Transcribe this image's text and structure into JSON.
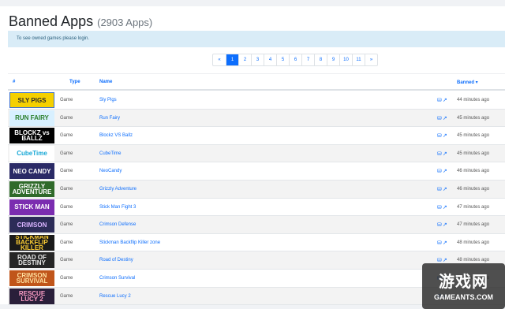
{
  "page": {
    "title": "Banned Apps",
    "count": "(2903 Apps)",
    "alert": "To see owned games please login."
  },
  "pagination": [
    "«",
    "1",
    "2",
    "3",
    "4",
    "5",
    "6",
    "7",
    "8",
    "9",
    "10",
    "11",
    "»"
  ],
  "pagination_active": "1",
  "table": {
    "headers": {
      "num": "#",
      "type": "Type",
      "name": "Name",
      "banned": "Banned ▾"
    },
    "rows": [
      {
        "thumb": "SLY PIGS",
        "type": "Game",
        "name": "Sly Pigs",
        "when": "44 minutes ago",
        "bg": "#f5d000",
        "fg": "#2b2b2b",
        "frame": "#3a6fd0"
      },
      {
        "thumb": "RUN FAIRY",
        "type": "Game",
        "name": "Run Fairy",
        "when": "45 minutes ago",
        "bg": "#d8f0ff",
        "fg": "#2b7f2b",
        "frame": "#d8f0ff"
      },
      {
        "thumb": "BLOCKZ vs BALLZ",
        "type": "Game",
        "name": "Blockz VS Ballz",
        "when": "45 minutes ago",
        "bg": "#000000",
        "fg": "#ffffff",
        "frame": "#000000"
      },
      {
        "thumb": "CubeTime",
        "type": "Game",
        "name": "CubeTime",
        "when": "45 minutes ago",
        "bg": "#ffffff",
        "fg": "#17a8d6",
        "frame": "#ffffff"
      },
      {
        "thumb": "NEO CANDY",
        "type": "Game",
        "name": "NeoCandy",
        "when": "46 minutes ago",
        "bg": "#2a2a66",
        "fg": "#ffffff",
        "frame": "#2a2a66"
      },
      {
        "thumb": "GRIZZLY ADVENTURE",
        "type": "Game",
        "name": "Grizzly Adventure",
        "when": "46 minutes ago",
        "bg": "#2f6a2a",
        "fg": "#ffffff",
        "frame": "#2f6a2a"
      },
      {
        "thumb": "STICK MAN",
        "type": "Game",
        "name": "Stick Man Fight 3",
        "when": "47 minutes ago",
        "bg": "#7b2db0",
        "fg": "#ffffff",
        "frame": "#7b2db0"
      },
      {
        "thumb": "CRIMSON",
        "type": "Game",
        "name": "Crimson Defense",
        "when": "47 minutes ago",
        "bg": "#2c2c58",
        "fg": "#d9b3ff",
        "frame": "#2c2c58"
      },
      {
        "thumb": "STICKMAN BACKFLIP KILLER",
        "type": "Game",
        "name": "Stickman Backflip Killer zone",
        "when": "48 minutes ago",
        "bg": "#1a1a1a",
        "fg": "#ffcf33",
        "frame": "#1a1a1a"
      },
      {
        "thumb": "ROAD OF DESTINY",
        "type": "Game",
        "name": "Road of Destiny",
        "when": "48 minutes ago",
        "bg": "#262626",
        "fg": "#e8e8e8",
        "frame": "#262626"
      },
      {
        "thumb": "CRIMSON SURVIVAL",
        "type": "Game",
        "name": "Crimson Survival",
        "when": "48 minutes ago",
        "bg": "#c0551a",
        "fg": "#ffe0a0",
        "frame": "#c0551a"
      },
      {
        "thumb": "RESCUE LUCY 2",
        "type": "Game",
        "name": "Rescue Lucy 2",
        "when": "",
        "bg": "#2a1f3a",
        "fg": "#ff9fc7",
        "frame": "#2a1f3a"
      }
    ]
  },
  "icons": {
    "row": [
      "database-icon",
      "link-icon"
    ]
  },
  "watermark": {
    "big": "游戏网",
    "small": "GAMEANTS.COM"
  }
}
